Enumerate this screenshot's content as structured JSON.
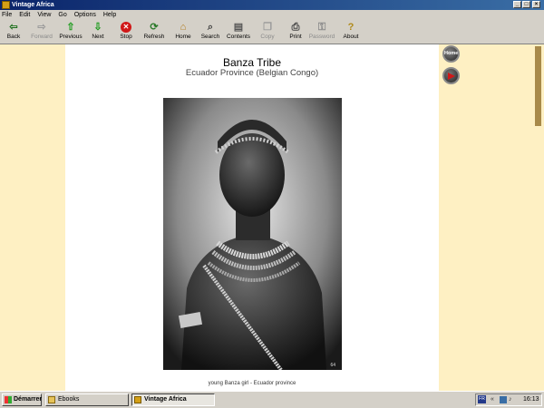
{
  "window": {
    "title": "Vintage Africa"
  },
  "menu": [
    "File",
    "Edit",
    "View",
    "Go",
    "Options",
    "Help"
  ],
  "toolbar": [
    {
      "label": "Back",
      "icon": "back-arrow-icon",
      "enabled": true
    },
    {
      "label": "Forward",
      "icon": "forward-arrow-icon",
      "enabled": false
    },
    {
      "label": "Previous",
      "icon": "up-arrow-icon",
      "enabled": true
    },
    {
      "label": "Next",
      "icon": "down-arrow-icon",
      "enabled": true
    },
    {
      "label": "Stop",
      "icon": "stop-icon",
      "enabled": true
    },
    {
      "label": "Refresh",
      "icon": "refresh-icon",
      "enabled": true
    },
    {
      "label": "Home",
      "icon": "home-icon",
      "enabled": true
    },
    {
      "label": "Search",
      "icon": "search-icon",
      "enabled": true
    },
    {
      "label": "Contents",
      "icon": "contents-icon",
      "enabled": true
    },
    {
      "label": "Copy",
      "icon": "copy-icon",
      "enabled": false
    },
    {
      "label": "Print",
      "icon": "print-icon",
      "enabled": true
    },
    {
      "label": "Password",
      "icon": "key-icon",
      "enabled": false
    },
    {
      "label": "About",
      "icon": "question-icon",
      "enabled": true
    }
  ],
  "page": {
    "title": "Banza Tribe",
    "subtitle": "Ecuador Province (Belgian Congo)",
    "caption": "young Banza girl - Ecuador province",
    "photo_badge": "64"
  },
  "side_buttons": {
    "home_label": "Home"
  },
  "taskbar": {
    "start_label": "Démarrer",
    "items": [
      {
        "label": "Ebooks",
        "active": false
      },
      {
        "label": "Vintage Africa",
        "active": true
      }
    ],
    "lang": "FR",
    "clock": "16:13"
  },
  "colors": {
    "page_background": "#fef0c3",
    "titlebar": "#0a246a"
  }
}
